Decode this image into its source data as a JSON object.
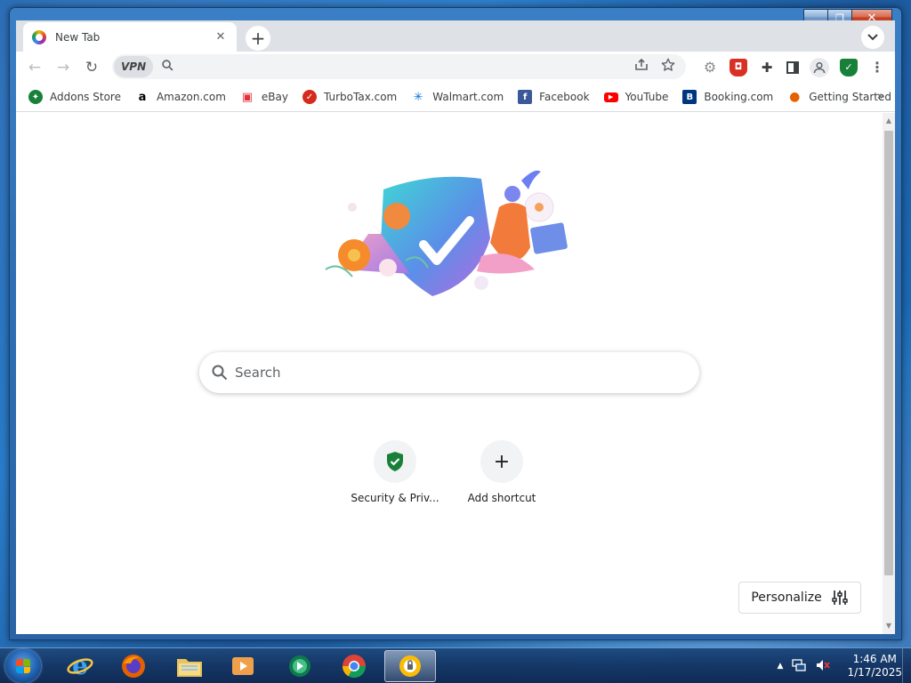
{
  "window": {
    "caption": {
      "minimize": "▁",
      "maximize": "❐",
      "close": "✕"
    }
  },
  "tab": {
    "title": "New Tab",
    "close": "✕"
  },
  "tabstrip": {
    "new_tab": "+",
    "tab_search": "⌄"
  },
  "toolbar": {
    "back": "←",
    "forward": "→",
    "reload": "↻",
    "vpn_label": "VPN",
    "omnibox_value": "",
    "omnibox_placeholder": ""
  },
  "bookmarks": [
    {
      "label": "Addons Store",
      "icon": "addons-store-icon",
      "color": "#188038"
    },
    {
      "label": "Amazon.com",
      "icon": "amazon-icon",
      "color": "#000000"
    },
    {
      "label": "eBay",
      "icon": "ebay-icon",
      "color": "#e53238"
    },
    {
      "label": "TurboTax.com",
      "icon": "turbotax-icon",
      "color": "#d52b1e"
    },
    {
      "label": "Walmart.com",
      "icon": "walmart-icon",
      "color": "#0071ce"
    },
    {
      "label": "Facebook",
      "icon": "facebook-icon",
      "color": "#3b5998"
    },
    {
      "label": "YouTube",
      "icon": "youtube-icon",
      "color": "#ff0000"
    },
    {
      "label": "Booking.com",
      "icon": "booking-icon",
      "color": "#003580"
    },
    {
      "label": "Getting Started",
      "icon": "firefox-icon",
      "color": "#e66000"
    }
  ],
  "bookmarks_more": "»",
  "search": {
    "placeholder": "Search"
  },
  "shortcuts": [
    {
      "label": "Security & Priv...",
      "icon": "green-shield-check-icon"
    },
    {
      "label": "Add shortcut",
      "icon": "plus-icon",
      "glyph": "+"
    }
  ],
  "personalize": {
    "label": "Personalize"
  },
  "taskbar": {
    "items": [
      "internet-explorer-icon",
      "firefox-icon",
      "file-explorer-icon",
      "media-player-icon",
      "media-center-icon",
      "chrome-like-icon",
      "vpn-browser-icon"
    ],
    "clock_time": "1:46 AM",
    "clock_date": "1/17/2025"
  },
  "colors": {
    "accent_green": "#188038",
    "chrome_tabstrip": "#dee1e6",
    "win7_blue": "#2a64a6"
  }
}
